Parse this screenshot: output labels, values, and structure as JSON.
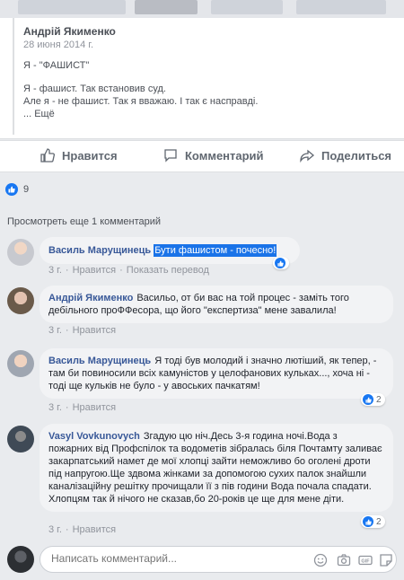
{
  "shared_post": {
    "author": "Андрій Якименко",
    "date": "28 июня 2014 г.",
    "lines": [
      "Я - \"ФАШИСТ\"",
      "",
      "Я - фашист. Так встановив суд.",
      "Але я - не фашист. Так я вважаю. І так є насправді.",
      "... Ещё"
    ]
  },
  "actions": {
    "like": "Нравится",
    "comment": "Комментарий",
    "share": "Поделиться"
  },
  "reactions": {
    "count": "9"
  },
  "view_more": "Просмотреть еще 1 комментарий",
  "comments": [
    {
      "author": "Василь Марущинець",
      "text": "Бути фашистом - почесно!",
      "time": "3 г.",
      "like": "Нравится",
      "translate": "Показать перевод"
    },
    {
      "author": "Андрій Якименко",
      "text": "Васильо, от би вас на той процес - заміть того дебільного проФФесора, що його \"експертиза\" мене завалила!",
      "time": "3 г.",
      "like": "Нравится"
    },
    {
      "author": "Василь Марущинець",
      "text": "Я тоді був молодий і значно лютіший, як тепер, - там би повиносили всіх камуністов у целофанових кульках..., хоча ні - тоді ще кульків не було - у авоських пачкатям!",
      "time": "3 г.",
      "like": "Нравится",
      "reactions": "2"
    },
    {
      "author": "Vasyl Vovkunovych",
      "text": "Згадую цю ніч.Десь 3-я година ночі.Вода з пожарних від Профспілок та водометів зібралась біля Почтамту заливає закарпатський намет де мої хлопці зайти неможливо бо оголені дроти під напругою.Ще здвома жінками за допомогою сухих палок знайшли каналізаційну решітку прочищали її з пів години Вода почала спадати. Хлопцям так й нічого не сказав,бо 20-років це ще для мене діти.",
      "time": "3 г.",
      "like": "Нравится",
      "reactions": "2"
    }
  ],
  "composer": {
    "placeholder": "Написать комментарий..."
  },
  "colors": {
    "link": "#385898",
    "accent": "#1877f2",
    "bg": "#e9ebee",
    "bubble": "#f2f3f5"
  }
}
